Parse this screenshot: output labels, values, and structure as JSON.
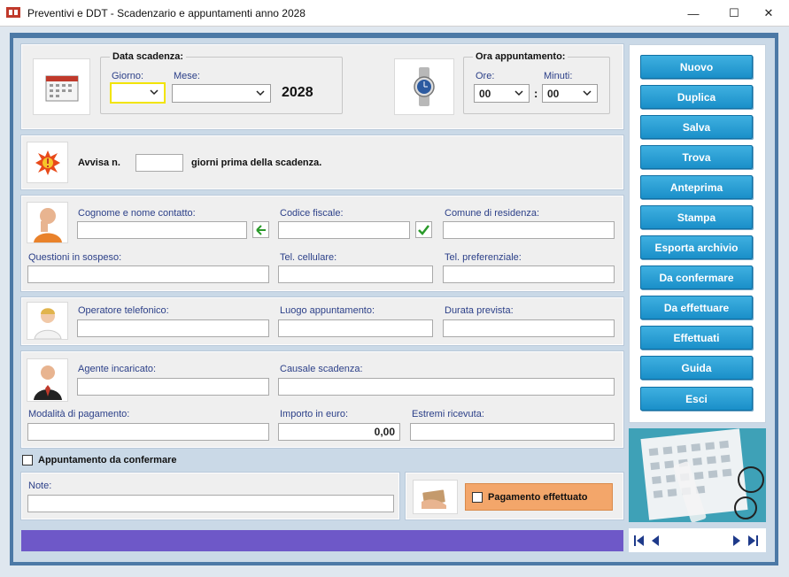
{
  "window": {
    "title": "Preventivi e DDT - Scadenzario e appuntamenti anno 2028",
    "minimize": "—",
    "maximize": "☐",
    "close": "✕"
  },
  "scadenza": {
    "legend": "Data scadenza:",
    "giorno_label": "Giorno:",
    "giorno_value": "",
    "mese_label": "Mese:",
    "mese_value": "",
    "anno": "2028"
  },
  "appuntamento": {
    "legend": "Ora appuntamento:",
    "ore_label": "Ore:",
    "ore_value": "00",
    "minuti_label": "Minuti:",
    "minuti_value": "00",
    "separator": ":"
  },
  "avviso": {
    "prefix": "Avvisa n.",
    "value": "",
    "suffix": "giorni prima della scadenza."
  },
  "contatto": {
    "cognome_label": "Cognome e nome contatto:",
    "cognome_value": "",
    "codice_label": "Codice fiscale:",
    "codice_value": "",
    "comune_label": "Comune di residenza:",
    "comune_value": "",
    "questioni_label": "Questioni in sospeso:",
    "questioni_value": "",
    "cellulare_label": "Tel. cellulare:",
    "cellulare_value": "",
    "preferenziale_label": "Tel. preferenziale:",
    "preferenziale_value": ""
  },
  "operatore": {
    "operatore_label": "Operatore telefonico:",
    "operatore_value": "",
    "luogo_label": "Luogo appuntamento:",
    "luogo_value": "",
    "durata_label": "Durata prevista:",
    "durata_value": ""
  },
  "agente": {
    "agente_label": "Agente incaricato:",
    "agente_value": "",
    "causale_label": "Causale scadenza:",
    "causale_value": "",
    "modalita_label": "Modalità di pagamento:",
    "modalita_value": "",
    "importo_label": "Importo in euro:",
    "importo_value": "0,00",
    "estremi_label": "Estremi ricevuta:",
    "estremi_value": ""
  },
  "conferma_label": "Appuntamento da confermare",
  "note_label": "Note:",
  "note_value": "",
  "pagamento_label": "Pagamento effettuato",
  "buttons": [
    "Nuovo",
    "Duplica",
    "Salva",
    "Trova",
    "Anteprima",
    "Stampa",
    "Esporta archivio",
    "Da confermare",
    "Da effettuare",
    "Effettuati",
    "Guida",
    "Esci"
  ],
  "colors": {
    "button": "#1d93cc",
    "progress": "#6e58c8",
    "payment_box": "#f3a66a",
    "border_blue": "#4c79a6"
  }
}
